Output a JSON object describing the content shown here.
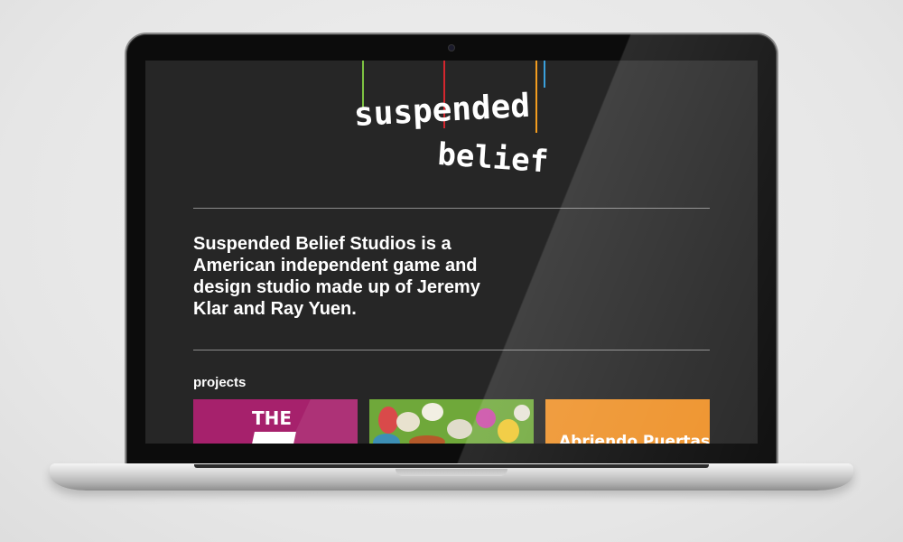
{
  "site": {
    "logo_line1": "suspended",
    "logo_line2": "belief",
    "intro": "Suspended Belief Studios is a American independent game and design studio made up of Jeremy Klar and Ray Yuen.",
    "projects_heading": "projects",
    "projects": [
      {
        "label": "THE",
        "color": "#a6216c"
      },
      {
        "label": "",
        "color": "#6fa83a"
      },
      {
        "label": "Abriendo Puertas",
        "color": "#ee922a"
      }
    ]
  },
  "colors": {
    "background": "#262626",
    "text": "#ffffff",
    "divider": "#8c8c8c",
    "string_green": "#7dc242",
    "string_red": "#d4262e",
    "string_orange": "#f39c1f",
    "string_blue": "#3aa0dc"
  }
}
